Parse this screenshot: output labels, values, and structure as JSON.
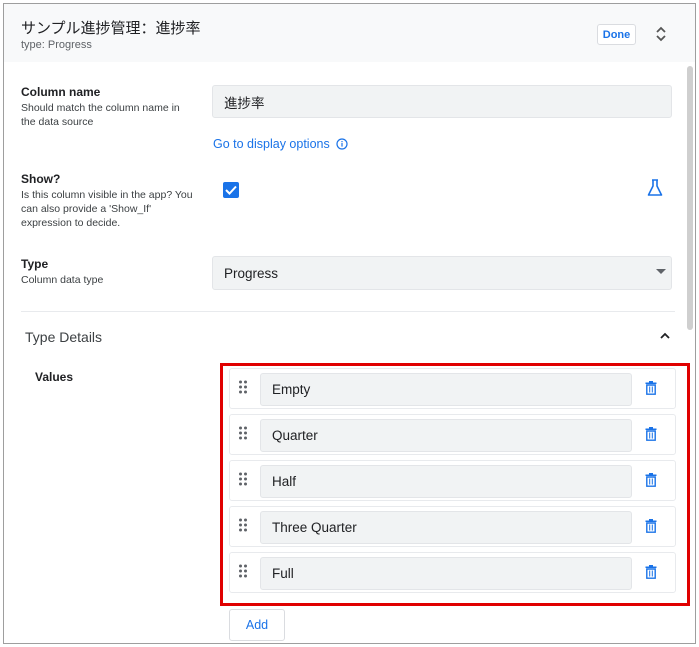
{
  "header": {
    "title": "サンプル進捗管理：進捗率",
    "subtitle": "type: Progress",
    "done_label": "Done"
  },
  "column_name": {
    "title": "Column name",
    "description": "Should match the column name in the data source",
    "value": "進捗率",
    "link_label": "Go to display options"
  },
  "show": {
    "title": "Show?",
    "description": "Is this column visible in the app? You can also provide a 'Show_If' expression to decide.",
    "checked": true
  },
  "type": {
    "title": "Type",
    "description": "Column data type",
    "value": "Progress"
  },
  "type_details": {
    "section_title": "Type Details",
    "values_label": "Values",
    "values": [
      "Empty",
      "Quarter",
      "Half",
      "Three Quarter",
      "Full"
    ],
    "add_label": "Add"
  },
  "colors": {
    "accent": "#1a73e8",
    "highlight": "#e00000",
    "input_bg": "#f1f3f4"
  }
}
